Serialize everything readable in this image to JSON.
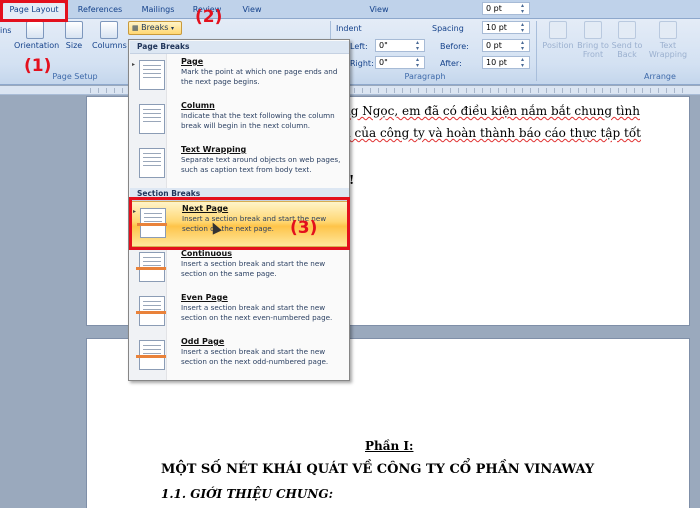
{
  "tabs": [
    "Page Layout",
    "References",
    "Mailings",
    "Review",
    "View",
    "View"
  ],
  "ribbon": {
    "page_setup": {
      "label": "Page Setup",
      "orientation": "Orientation",
      "size": "Size",
      "columns": "Columns",
      "margins_fragment": "ins"
    },
    "breaks_label": "Breaks",
    "indent_label": "Indent",
    "spacing_label": "Spacing",
    "left_label": "Left:",
    "right_label": "Right:",
    "before_label": "Before:",
    "after_label": "After:",
    "indent_left": "0\"",
    "indent_right": "0\"",
    "space_before": "0 pt",
    "space_after": "10 pt",
    "top_spin1": "0 pt",
    "top_spin2": "10 pt",
    "paragraph_label": "Paragraph",
    "arrange_label": "Arrange",
    "arrange": {
      "position": "Position",
      "bring_to_front": "Bring to Front",
      "send_to_back": "Send to Back",
      "text_wrapping": "Text Wrapping",
      "position2": "Position",
      "bring_to_front2": "Bring to Front",
      "send_to_back2": "Send to Back"
    }
  },
  "menu": {
    "page_breaks_header": "Page Breaks",
    "section_breaks_header": "Section Breaks",
    "items": [
      {
        "title": "Page",
        "desc": "Mark the point at which one page ends and the next page begins."
      },
      {
        "title": "Column",
        "desc": "Indicate that the text following the column break will begin in the next column."
      },
      {
        "title": "Text Wrapping",
        "desc": "Separate text around objects on web pages, such as caption text from body text."
      },
      {
        "title": "Next Page",
        "desc": "Insert a section break and start the new section on the next page."
      },
      {
        "title": "Continuous",
        "desc": "Insert a section break and start the new section on the same page."
      },
      {
        "title": "Even Page",
        "desc": "Insert a section break and start the new section on the next even-numbered page."
      },
      {
        "title": "Odd Page",
        "desc": "Insert a section break and start the new section on the next odd-numbered page."
      }
    ]
  },
  "document": {
    "line1": "ng Ngọc, em đã có điều kiện nắm bắt chung tình",
    "line2": "n của công ty và hoàn thành báo cáo thực tập tốt",
    "line3": "!",
    "part": "Phần I:",
    "heading": "MỘT SỐ NÉT KHÁI QUÁT VỀ CÔNG TY CỔ PHẦN VINAWAY",
    "subheading": "1.1. GIỚI THIỆU CHUNG:"
  },
  "annotations": {
    "one": "(1)",
    "two": "(2)",
    "three": "(3)"
  }
}
